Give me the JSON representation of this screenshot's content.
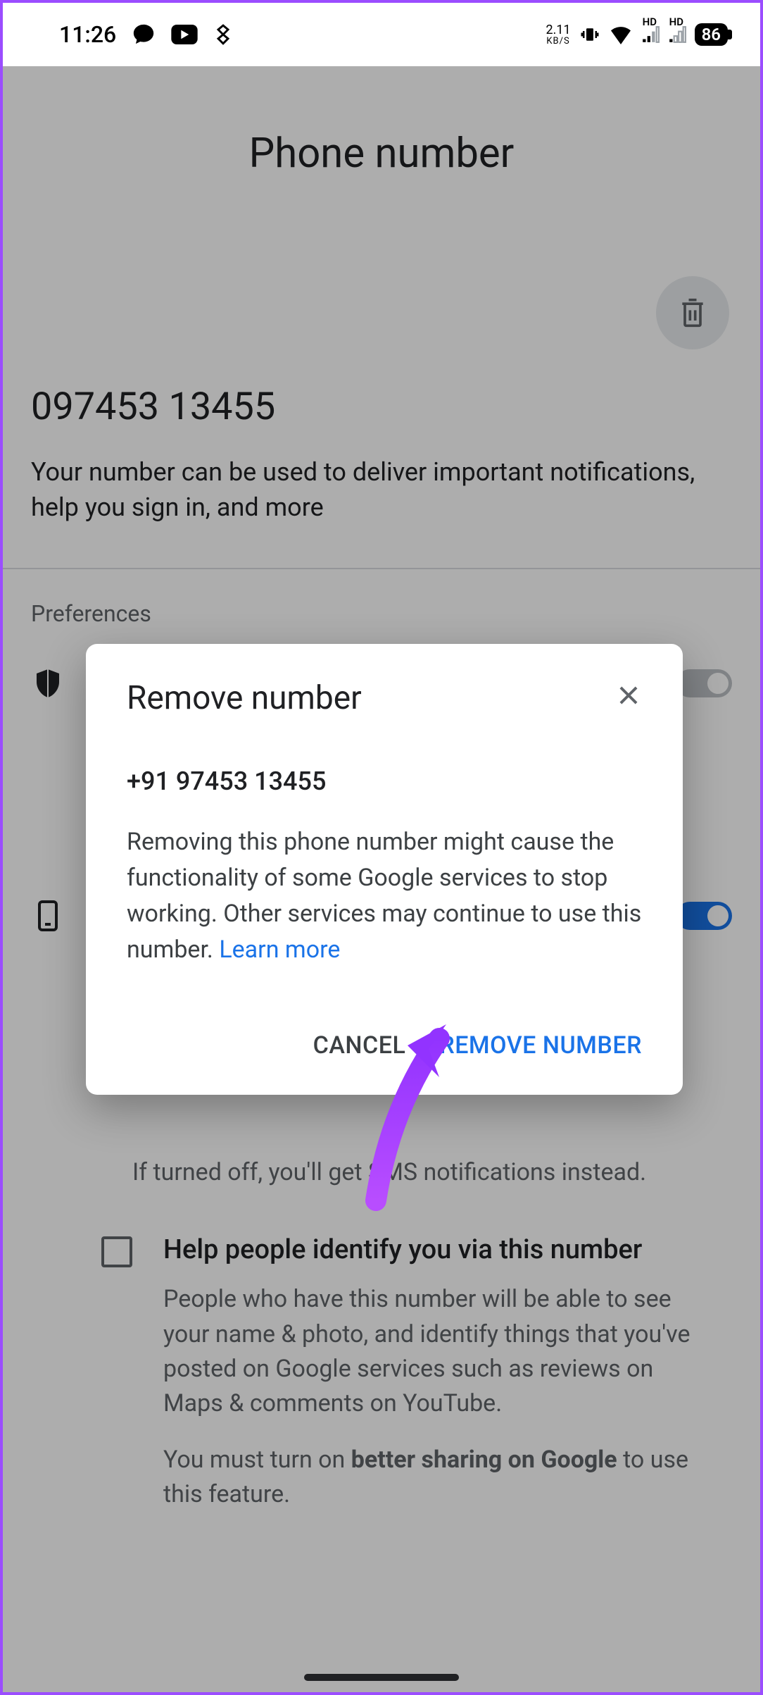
{
  "statusBar": {
    "time": "11:26",
    "kbps": "2.11",
    "kbpsUnit": "KB/S",
    "battery": "86",
    "hd1": "HD",
    "hd2": "HD"
  },
  "page": {
    "title": "Phone number",
    "phoneNumber": "097453 13455",
    "description": "Your number can be used to deliver important notifications, help you sign in, and more",
    "preferencesLabel": "Preferences",
    "trailingDesc": "If turned off, you'll get SMS notifications instead.",
    "checkbox": {
      "title": "Help people identify you via this number",
      "desc": "People who have this number will be able to see your name & photo, and identify things that you've posted on Google services such as reviews on Maps & comments on YouTube.",
      "notePrefix": "You must turn on ",
      "noteBold": "better sharing on Google",
      "noteSuffix": " to use this feature."
    }
  },
  "dialog": {
    "title": "Remove number",
    "number": "+91 97453 13455",
    "body": "Removing this phone number might cause the functionality of some Google services to stop working. Other services may continue to use this number. ",
    "learnMore": "Learn more",
    "cancel": "CANCEL",
    "confirm": "REMOVE NUMBER"
  }
}
